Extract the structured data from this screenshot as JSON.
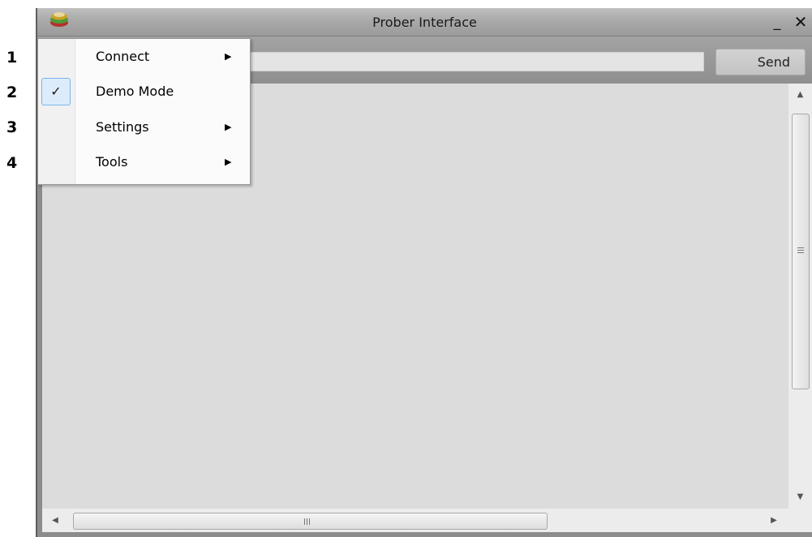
{
  "window": {
    "title": "Prober Interface",
    "minimize_glyph": "_",
    "close_glyph": "✕"
  },
  "command_bar": {
    "input_value": "",
    "send_label": "Send"
  },
  "menu": {
    "items": [
      {
        "label": "Connect",
        "has_submenu": true,
        "checked": false
      },
      {
        "label": "Demo Mode",
        "has_submenu": false,
        "checked": true
      },
      {
        "label": "Settings",
        "has_submenu": true,
        "checked": false
      },
      {
        "label": "Tools",
        "has_submenu": true,
        "checked": false
      }
    ],
    "submenu_glyph": "▶",
    "check_glyph": "✓"
  },
  "callouts": [
    "1",
    "2",
    "3",
    "4"
  ],
  "scrollbars": {
    "up_glyph": "▲",
    "down_glyph": "▼",
    "left_glyph": "◀",
    "right_glyph": "▶"
  },
  "colors": {
    "titlebar": "#a9a9a9",
    "log_background": "#dcdcdc",
    "menu_check_highlight": "#dcecfb"
  },
  "icons": [
    "app-logo-icon",
    "minimize-icon",
    "close-icon",
    "checkmark-icon",
    "submenu-arrow-icon",
    "scroll-up-icon",
    "scroll-down-icon",
    "scroll-left-icon",
    "scroll-right-icon"
  ]
}
